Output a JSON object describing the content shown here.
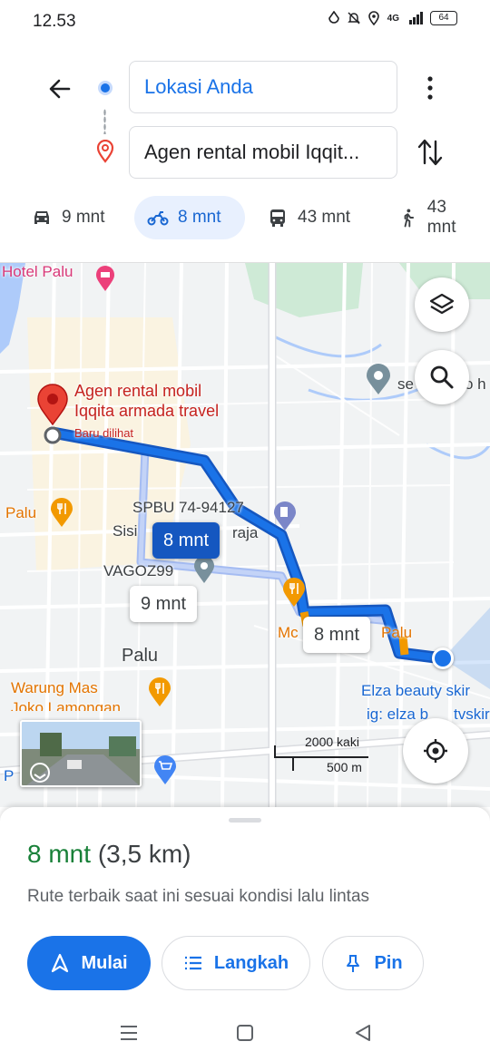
{
  "status_bar": {
    "time": "12.53",
    "network": "4G",
    "battery": "64"
  },
  "search": {
    "origin": "Lokasi Anda",
    "destination": "Agen rental mobil Iqqit..."
  },
  "modes": [
    {
      "name": "car",
      "label": "9 mnt",
      "active": false
    },
    {
      "name": "motorcycle",
      "label": "8 mnt",
      "active": true
    },
    {
      "name": "transit",
      "label": "43 mnt",
      "active": false
    },
    {
      "name": "walk",
      "label": "43 mnt",
      "active": false
    }
  ],
  "map": {
    "labels": {
      "hotel": "Hotel Palu",
      "dest_line1": "Agen rental mobil",
      "dest_line2": "Iqqita armada travel",
      "recent": "Baru dilihat",
      "palu_food": "Palu",
      "spbu": "SPBU 74-94127",
      "sisi": "Sisi",
      "raja": "raja",
      "vagoz": "VAGOZ99",
      "palu": "Palu",
      "warung1": "Warung Mas",
      "warung2": "Joko Lamongan",
      "mc": "Mc",
      "palu_right": "Palu",
      "elza1": "Elza beauty skir",
      "elza2": "ig: elza b",
      "elza3": "tvskir",
      "se": "se",
      "h": "o h",
      "p": "P"
    },
    "route_bubbles": {
      "selected": "8 mnt",
      "alt1": "9 mnt",
      "alt2": "8 mnt"
    },
    "scale": {
      "imperial": "2000 kaki",
      "metric": "500 m"
    }
  },
  "sheet": {
    "duration": "8 mnt",
    "distance": "(3,5 km)",
    "description": "Rute terbaik saat ini sesuai kondisi lalu lintas",
    "buttons": {
      "start": "Mulai",
      "steps": "Langkah",
      "pin": "Pin"
    }
  },
  "colors": {
    "accent": "#1a73e8",
    "duration_green": "#188038",
    "route": "#1a73e8",
    "route_dark": "#1557c0",
    "traffic": "#f29900",
    "dest_pin": "#ea4335"
  }
}
